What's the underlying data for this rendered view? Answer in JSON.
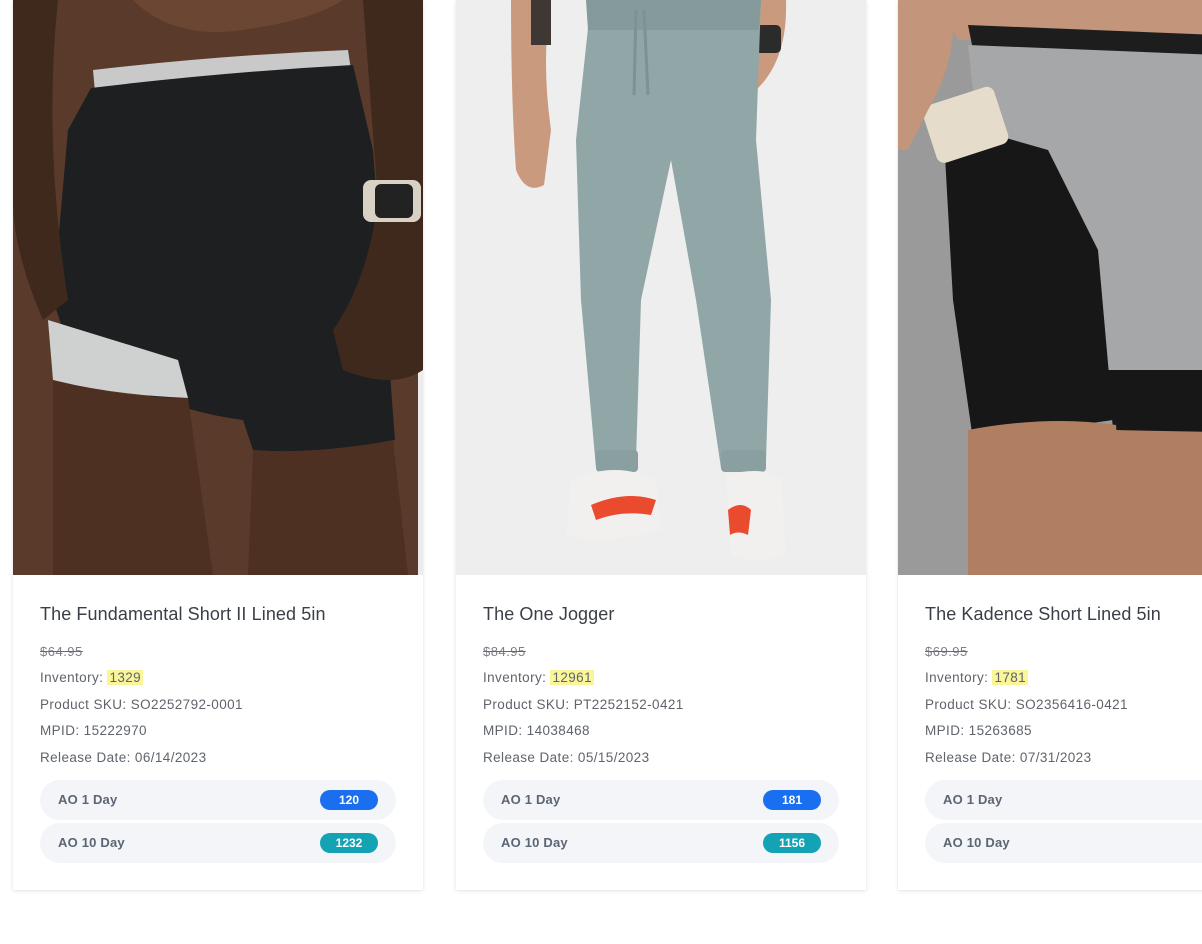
{
  "products": [
    {
      "title": "The Fundamental Short II Lined 5in",
      "price": "$64.95",
      "inventory_label": "Inventory:",
      "inventory": "1329",
      "sku_label": "Product SKU:",
      "sku": "SO2252792-0001",
      "mpid_label": "MPID:",
      "mpid": "15222970",
      "release_label": "Release Date:",
      "release_date": "06/14/2023",
      "stats": [
        {
          "label": "AO 1 Day",
          "value": "120",
          "color": "#1a6ff0"
        },
        {
          "label": "AO 10 Day",
          "value": "1232",
          "color": "#14a2b5"
        }
      ]
    },
    {
      "title": "The One Jogger",
      "price": "$84.95",
      "inventory_label": "Inventory:",
      "inventory": "12961",
      "sku_label": "Product SKU:",
      "sku": "PT2252152-0421",
      "mpid_label": "MPID:",
      "mpid": "14038468",
      "release_label": "Release Date:",
      "release_date": "05/15/2023",
      "stats": [
        {
          "label": "AO 1 Day",
          "value": "181",
          "color": "#1a6ff0"
        },
        {
          "label": "AO 10 Day",
          "value": "1156",
          "color": "#14a2b5"
        }
      ]
    },
    {
      "title": "The Kadence Short Lined 5in",
      "price": "$69.95",
      "inventory_label": "Inventory:",
      "inventory": "1781",
      "sku_label": "Product SKU:",
      "sku": "SO2356416-0421",
      "mpid_label": "MPID:",
      "mpid": "15263685",
      "release_label": "Release Date:",
      "release_date": "07/31/2023",
      "stats": [
        {
          "label": "AO 1 Day",
          "value": "",
          "color": "#1a6ff0"
        },
        {
          "label": "AO 10 Day",
          "value": "",
          "color": "#14a2b5"
        }
      ]
    }
  ],
  "colors": {
    "highlight": "#fbf59a",
    "strike": "#d23c3c",
    "pill_bg": "#f3f5f8"
  }
}
